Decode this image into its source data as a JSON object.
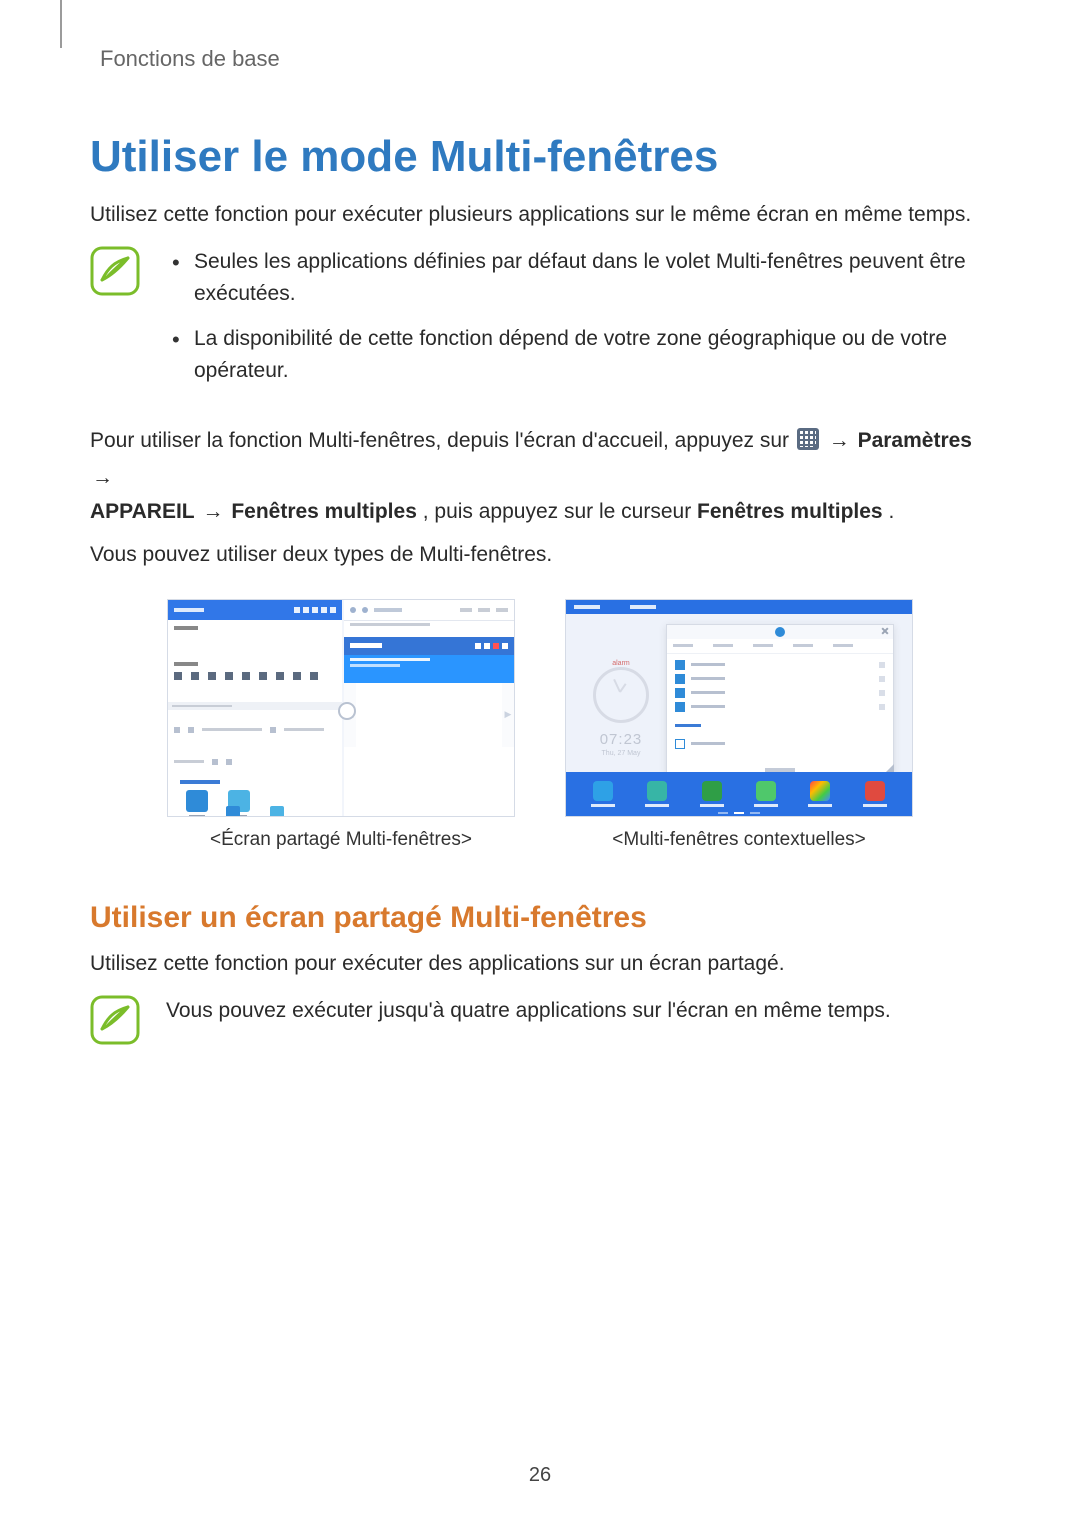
{
  "header": {
    "section": "Fonctions de base"
  },
  "title": "Utiliser le mode Multi-fenêtres",
  "intro": "Utilisez cette fonction pour exécuter plusieurs applications sur le même écran en même temps.",
  "note1": {
    "bullets": [
      "Seules les applications définies par défaut dans le volet Multi-fenêtres peuvent être exécutées.",
      "La disponibilité de cette fonction dépend de votre zone géographique ou de votre opérateur."
    ]
  },
  "instruction": {
    "part1": "Pour utiliser la fonction Multi-fenêtres, depuis l'écran d'accueil, appuyez sur ",
    "arrow": " → ",
    "settings": "Paramètres",
    "part2": "APPAREIL",
    "part3": "Fenêtres multiples",
    "part4": ", puis appuyez sur le curseur ",
    "part5": "Fenêtres multiples",
    "part6": "."
  },
  "para_types": "Vous pouvez utiliser deux types de Multi-fenêtres.",
  "figures": {
    "left_caption": "<Écran partagé Multi-fenêtres>",
    "right_caption": "<Multi-fenêtres contextuelles>",
    "clock_time": "07:23",
    "clock_date": "Thu, 27 May",
    "clock_label": "alarm"
  },
  "subheading": "Utiliser un écran partagé Multi-fenêtres",
  "sub_intro": "Utilisez cette fonction pour exécuter des applications sur un écran partagé.",
  "note2": "Vous pouvez exécuter jusqu'à quatre applications sur l'écran en même temps.",
  "page_number": "26",
  "icons": {
    "note": "note-icon",
    "apps_grid": "apps-grid-icon"
  }
}
